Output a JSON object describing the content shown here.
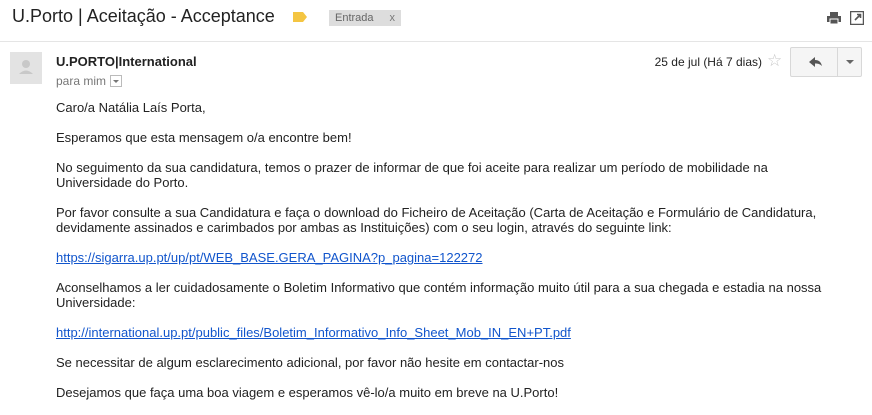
{
  "header": {
    "subject": "U.Porto | Aceitação - Acceptance",
    "label": "Entrada",
    "label_remove": "x",
    "importance_color": "#f4c542",
    "icons": [
      "print-icon",
      "new-window-icon"
    ]
  },
  "message": {
    "sender": "U.PORTO|International",
    "recipient": "para mim",
    "date": "25 de jul (Há 7 dias)",
    "avatar_icon": "person-icon",
    "star_icon": "star-icon",
    "reply_icon": "reply-icon",
    "more_icon": "chevron-down-icon"
  },
  "body": {
    "greeting": "Caro/a Natália Laís Porta,",
    "p1": "Esperamos que esta mensagem o/a encontre bem!",
    "p2": "No seguimento da sua candidatura, temos o prazer de informar de que foi aceite para realizar um período de mobilidade na Universidade do Porto.",
    "p3": "Por favor consulte a sua Candidatura e faça o download do Ficheiro de Aceitação (Carta de Aceitação e Formulário de Candidatura, devidamente assinados e carimbados por ambas as Instituições) com o seu login, através do seguinte link:",
    "link1": "https://sigarra.up.pt/up/pt/WEB_BASE.GERA_PAGINA?p_pagina=122272",
    "p4": "Aconselhamos a ler cuidadosamente o Boletim Informativo que contém informação muito útil para a sua chegada e estadia na nossa Universidade:",
    "link2": "http://international.up.pt/public_files/Boletim_Informativo_Info_Sheet_Mob_IN_EN+PT.pdf",
    "p5": "Se necessitar de algum esclarecimento adicional, por favor não hesite em contactar-nos",
    "p6": "Desejamos que faça uma boa viagem e esperamos vê-lo/a muito em breve na U.Porto!"
  },
  "colors": {
    "link": "#1155cc",
    "label_bg": "#dddddd",
    "muted": "#777777"
  }
}
